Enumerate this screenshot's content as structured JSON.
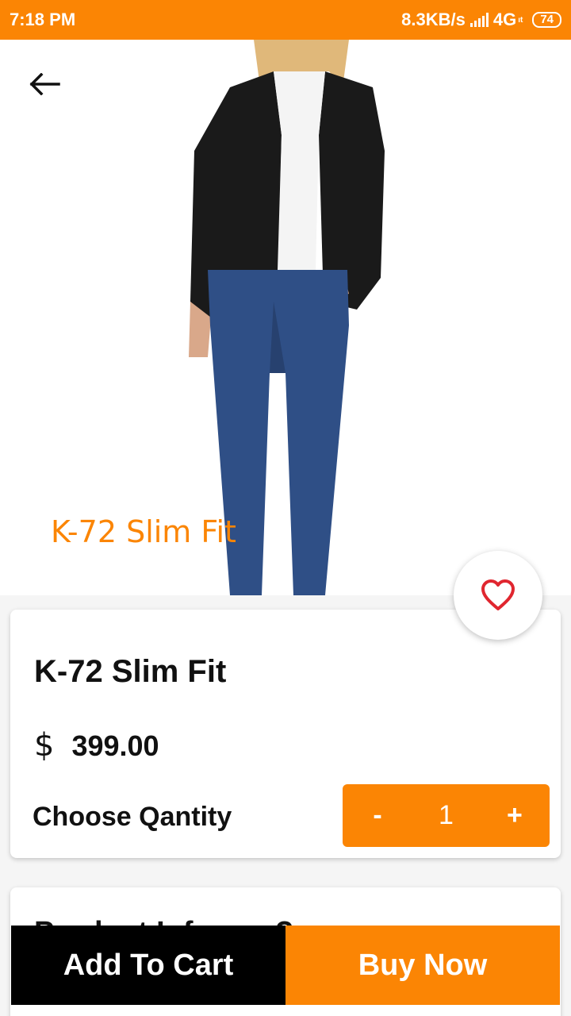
{
  "status_bar": {
    "time": "7:18 PM",
    "net_speed": "8.3KB/s",
    "network": "4G",
    "network_sub": "ıt",
    "battery": "74"
  },
  "hero": {
    "title": "K-72 Slim Fit",
    "back_icon": "arrow-left-icon",
    "image_desc_icon": "product-photo"
  },
  "product": {
    "name": "K-72 Slim Fit",
    "currency": "$",
    "price": "399.00",
    "qty_label": "Choose Qantity",
    "qty_minus": "-",
    "qty_value": "1",
    "qty_plus": "+",
    "favorite_icon": "heart-outline-icon"
  },
  "details": {
    "heading": "Product Inform...?"
  },
  "actions": {
    "add_to_cart": "Add To Cart",
    "buy_now": "Buy Now"
  },
  "colors": {
    "accent": "#fb8504",
    "heart": "#e0262f",
    "dark_button": "#000000"
  }
}
